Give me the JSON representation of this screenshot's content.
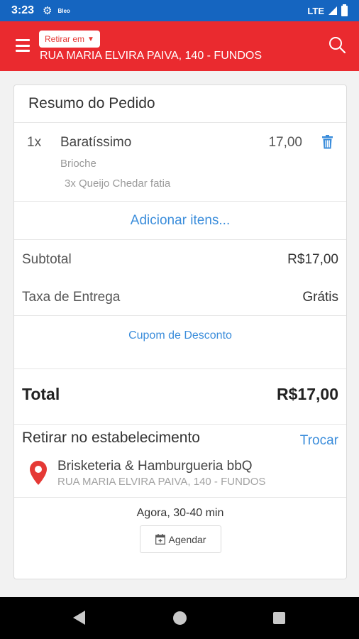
{
  "status_bar": {
    "time": "3:23",
    "settings_icon": "gear-icon",
    "notification_text": "Bleo",
    "network": "LTE"
  },
  "app_bar": {
    "menu_icon": "hamburger-icon",
    "mode_label": "Retirar em",
    "address": "RUA MARIA ELVIRA PAIVA, 140 - FUNDOS",
    "search_icon": "search-icon",
    "accent_color": "#ea2a2f"
  },
  "order": {
    "title": "Resumo do Pedido",
    "items": [
      {
        "qty": "1x",
        "name": "Baratíssimo",
        "price": "17,00",
        "options": [
          "Brioche",
          "3x Queijo Chedar fatia"
        ]
      }
    ],
    "add_items_label": "Adicionar itens...",
    "subtotal_label": "Subtotal",
    "subtotal_value": "R$17,00",
    "delivery_label": "Taxa de Entrega",
    "delivery_value": "Grátis",
    "coupon_label": "Cupom de Desconto",
    "total_label": "Total",
    "total_value": "R$17,00"
  },
  "pickup": {
    "title": "Retirar no estabelecimento",
    "change_label": "Trocar",
    "store_name": "Brisketeria & Hamburgueria bbQ",
    "store_address": "RUA MARIA ELVIRA PAIVA, 140 - FUNDOS",
    "eta": "Agora, 30-40 min",
    "schedule_label": "Agendar"
  },
  "colors": {
    "link": "#3b8ddb",
    "pin": "#e53935",
    "status_bar": "#1565c0"
  }
}
